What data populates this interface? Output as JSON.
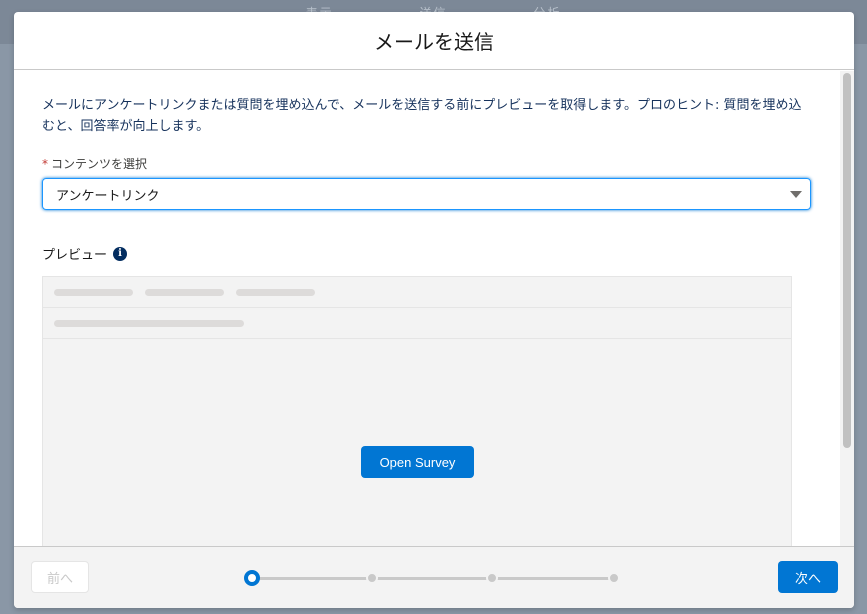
{
  "background": {
    "tabs": [
      "表示",
      "送信",
      "分析"
    ]
  },
  "modal": {
    "title": "メールを送信",
    "intro": "メールにアンケートリンクまたは質問を埋め込んで、メールを送信する前にプレビューを取得します。プロのヒント: 質問を埋め込むと、回答率が向上します。",
    "content_field": {
      "required_mark": "*",
      "label": "コンテンツを選択",
      "selected_value": "アンケートリンク"
    },
    "preview": {
      "label": "プレビュー",
      "info_icon": "i",
      "open_survey_label": "Open Survey"
    },
    "footer": {
      "prev_label": "前へ",
      "next_label": "次へ",
      "progress_steps": 4,
      "current_step": 1
    }
  },
  "colors": {
    "brand": "#0176d3",
    "title_text": "#16325c",
    "required": "#c23934"
  }
}
